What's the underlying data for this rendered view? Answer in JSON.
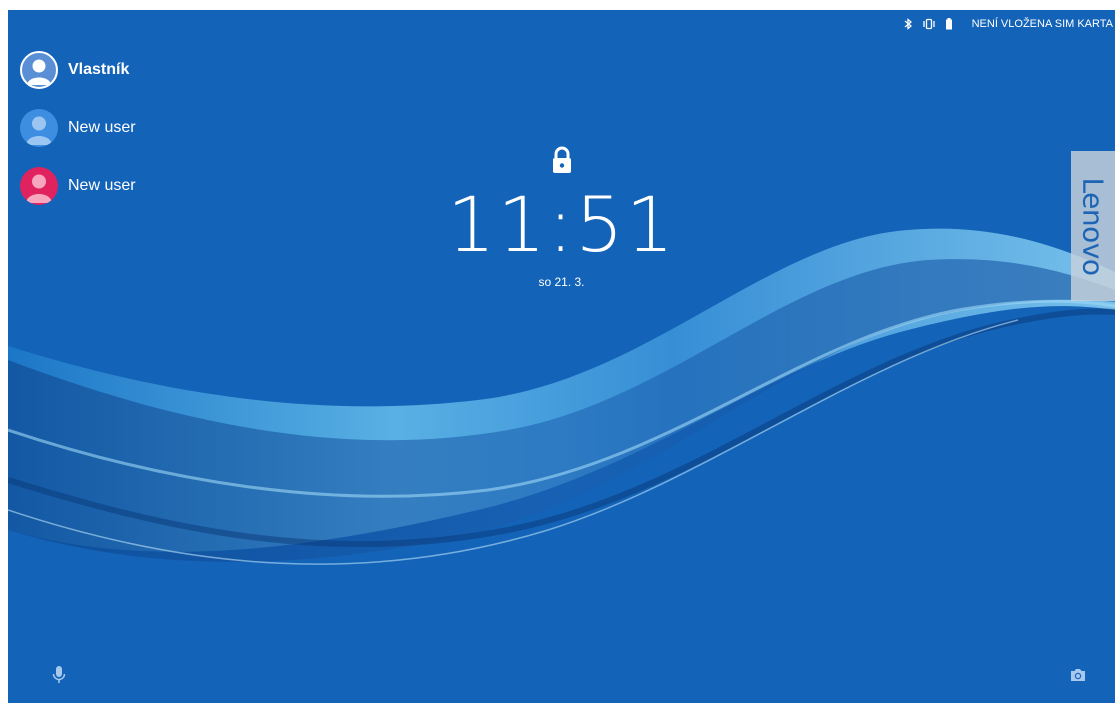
{
  "status_bar": {
    "sim_status": "NENÍ VLOŽENA SIM KARTA",
    "icons": [
      "bluetooth-icon",
      "vibrate-icon",
      "battery-icon"
    ]
  },
  "users": [
    {
      "name": "Vlastník",
      "avatar_color": "#5a8fd6",
      "active": true
    },
    {
      "name": "New user",
      "avatar_color": "#3d8de0",
      "active": false
    },
    {
      "name": "New user",
      "avatar_color": "#e0235f",
      "active": false
    }
  ],
  "lock": {
    "icon": "lock-icon",
    "time": "11:51",
    "date": "so 21. 3."
  },
  "brand": {
    "text": "Lenovo"
  },
  "shortcuts": {
    "left": "microphone-icon",
    "right": "camera-icon"
  },
  "colors": {
    "background": "#1363b8",
    "wave": "#5fb7e8",
    "brand_text": "#1d64b5"
  }
}
